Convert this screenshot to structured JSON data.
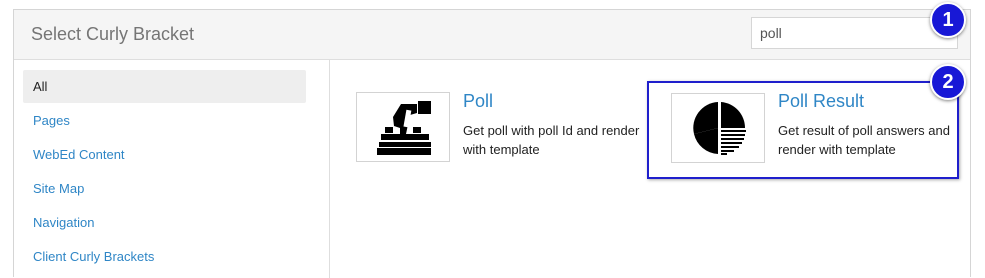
{
  "dialog": {
    "title": "Select Curly Bracket",
    "search": {
      "value": "poll",
      "placeholder": ""
    }
  },
  "sidebar": {
    "items": [
      {
        "label": "All",
        "active": true
      },
      {
        "label": "Pages"
      },
      {
        "label": "WebEd Content"
      },
      {
        "label": "Site Map"
      },
      {
        "label": "Navigation"
      },
      {
        "label": "Client Curly Brackets"
      }
    ]
  },
  "cards": [
    {
      "title": "Poll",
      "description": "Get poll with poll Id and render with template",
      "icon": "ballot-box-icon"
    },
    {
      "title": "Poll Result",
      "description": "Get result of poll answers and render with template",
      "icon": "pie-chart-icon"
    }
  ],
  "annotations": [
    {
      "number": "1"
    },
    {
      "number": "2"
    }
  ],
  "colors": {
    "link": "#2f86c6",
    "highlight_border": "#1f1fcc",
    "badge": "#1818d6"
  }
}
